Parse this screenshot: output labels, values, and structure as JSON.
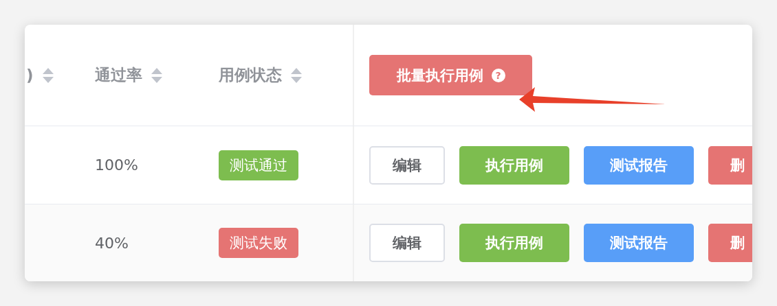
{
  "table": {
    "columns": [
      {
        "label": ")",
        "sortable": true
      },
      {
        "label": "通过率",
        "sortable": true
      },
      {
        "label": "用例状态",
        "sortable": true
      }
    ],
    "batch_button": {
      "label": "批量执行用例",
      "help_icon": "?"
    },
    "rows": [
      {
        "pass_rate": "100%",
        "status": {
          "label": "测试通过",
          "kind": "passed"
        },
        "actions": [
          {
            "label": "编辑",
            "kind": "plain"
          },
          {
            "label": "执行用例",
            "kind": "success"
          },
          {
            "label": "测试报告",
            "kind": "primary"
          },
          {
            "label": "删",
            "kind": "danger"
          }
        ]
      },
      {
        "pass_rate": "40%",
        "status": {
          "label": "测试失败",
          "kind": "failed"
        },
        "actions": [
          {
            "label": "编辑",
            "kind": "plain"
          },
          {
            "label": "执行用例",
            "kind": "success"
          },
          {
            "label": "测试报告",
            "kind": "primary"
          },
          {
            "label": "删",
            "kind": "danger"
          }
        ]
      }
    ]
  }
}
